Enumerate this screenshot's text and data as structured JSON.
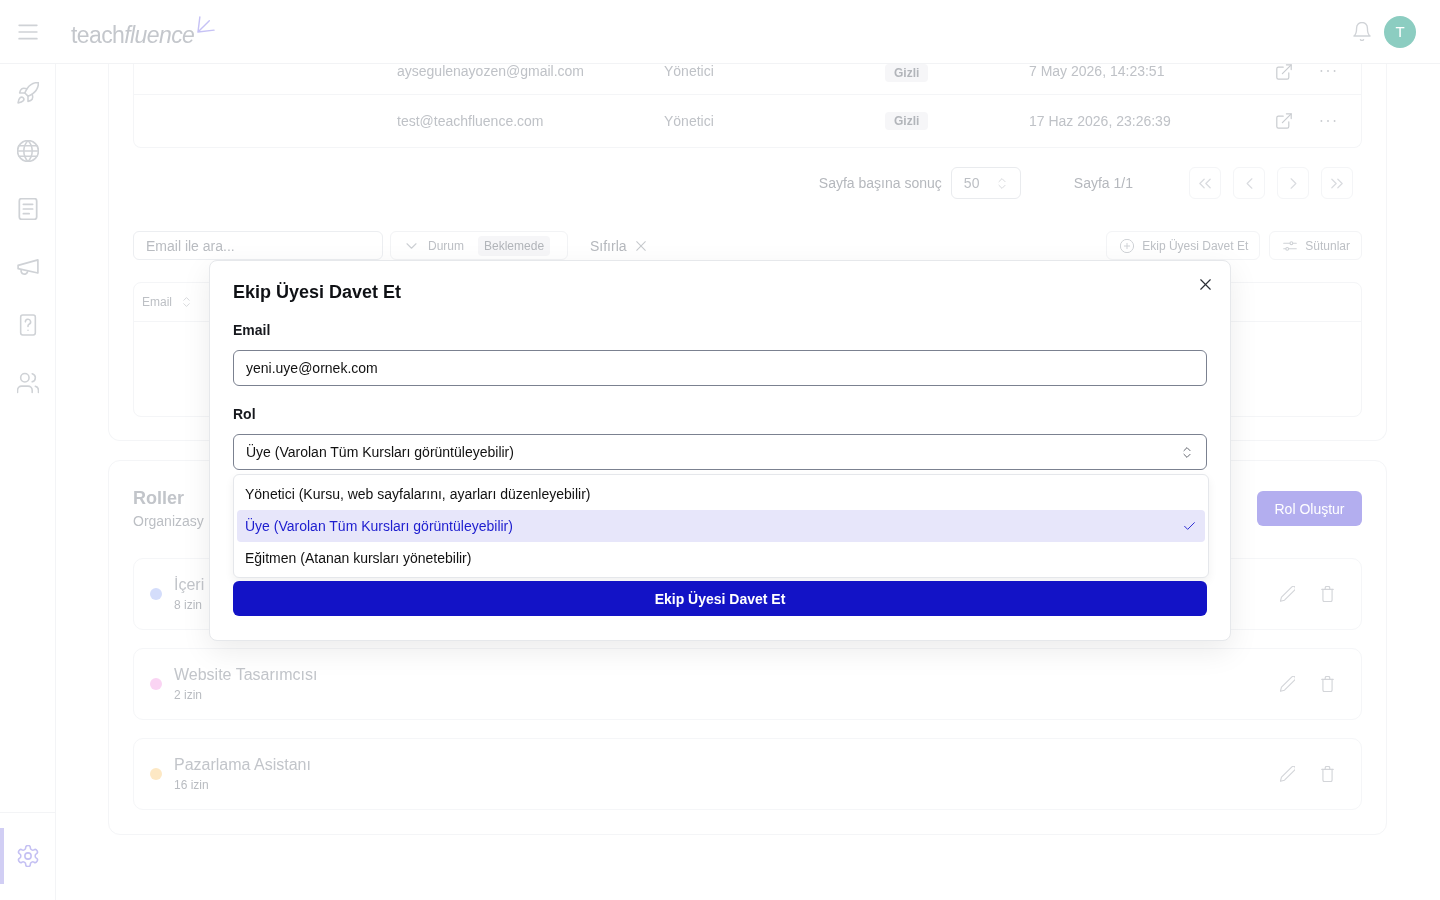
{
  "header": {
    "logo": {
      "text": "teach",
      "italic_text": "fluence"
    },
    "avatar_initial": "T"
  },
  "sidebar": {
    "items": [
      {
        "selected": false
      },
      {
        "selected": false
      },
      {
        "selected": false
      },
      {
        "selected": false
      },
      {
        "selected": false
      },
      {
        "selected": false
      }
    ],
    "footer_items": [
      {
        "selected": true
      }
    ]
  },
  "members_table": {
    "rows": [
      {
        "column_1": "aysegulenayozen@gmail.com",
        "column_2": "Yönetici",
        "column_3": "Gizli",
        "column_4": "7 May 2026, 14:23:51"
      },
      {
        "column_1": "test@teachfluence.com",
        "column_2": "Yönetici",
        "column_3": "Gizli",
        "column_4": "17 Haz 2026, 23:26:39"
      }
    ]
  },
  "pagination": {
    "per_page_label": "Sayfa başına sonuç",
    "per_page_value": "50",
    "page_label": "Sayfa 1/1"
  },
  "filters": {
    "search": {
      "placeholder": "Email ile ara..."
    },
    "status": {
      "label": "Durum",
      "value": "Beklemede"
    },
    "reset": "Sıfırla",
    "invite_button": "Ekip Üyesi Davet Et",
    "columns_button": "Sütunlar"
  },
  "invites_table": {
    "columns": [
      {
        "label": "Email"
      }
    ]
  },
  "roles": {
    "title": "Roller",
    "subtitle": "Organizasy",
    "create_button": "Rol Oluştur",
    "items": [
      {
        "name": "İçeri",
        "permissions": "8 izin",
        "color": "#d4ddfb"
      },
      {
        "name": "Website Tasarımcısı",
        "permissions": "2 izin",
        "color": "#fad4f3"
      },
      {
        "name": "Pazarlama Asistanı",
        "permissions": "16 izin",
        "color": "#fde8c4"
      }
    ]
  },
  "dialog": {
    "title": "Ekip Üyesi Davet Et",
    "email": {
      "label": "Email",
      "value": "yeni.uye@ornek.com"
    },
    "role": {
      "label": "Rol",
      "value": "Üye (Varolan Tüm Kursları görüntüleyebilir)",
      "expanded": true,
      "options": [
        {
          "label": "Yönetici (Kursu, web sayfalarını, ayarları düzenleyebilir)",
          "selected": false
        },
        {
          "label": "Üye (Varolan Tüm Kursları görüntüleyebilir)",
          "selected": true
        },
        {
          "label": "Eğitmen (Atanan kursları yönetebilir)",
          "selected": false
        }
      ]
    },
    "submit": "Ekip Üyesi Davet Et"
  }
}
